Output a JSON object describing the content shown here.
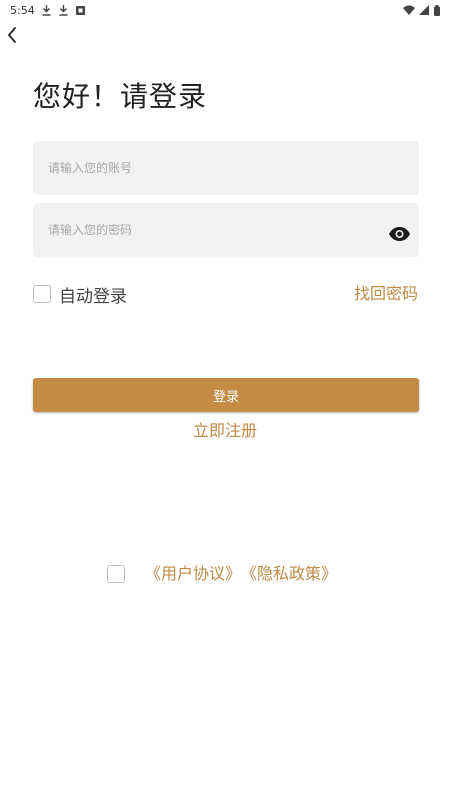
{
  "status_bar": {
    "time": "5:54",
    "left_icons": [
      "download-icon",
      "download-icon",
      "app-badge-icon"
    ],
    "right_icons": [
      "wifi-icon",
      "signal-icon",
      "battery-icon"
    ]
  },
  "nav": {
    "back_icon": "chevron-left-icon"
  },
  "title": "您好！请登录",
  "account_field": {
    "placeholder": "请输入您的账号",
    "value": ""
  },
  "password_field": {
    "placeholder": "请输入您的密码",
    "value": "",
    "toggle_icon": "eye-icon"
  },
  "auto_login": {
    "label": "自动登录",
    "checked": false
  },
  "forgot_password": "找回密码",
  "login_button": "登录",
  "register_link": "立即注册",
  "agreement": {
    "checked": false,
    "user_agreement": "《用户协议》",
    "privacy_policy": "《隐私政策》"
  },
  "colors": {
    "accent": "#c58a44",
    "link": "#bf8a45",
    "field_bg": "#f2f2f2",
    "placeholder": "#a8a8a8"
  }
}
